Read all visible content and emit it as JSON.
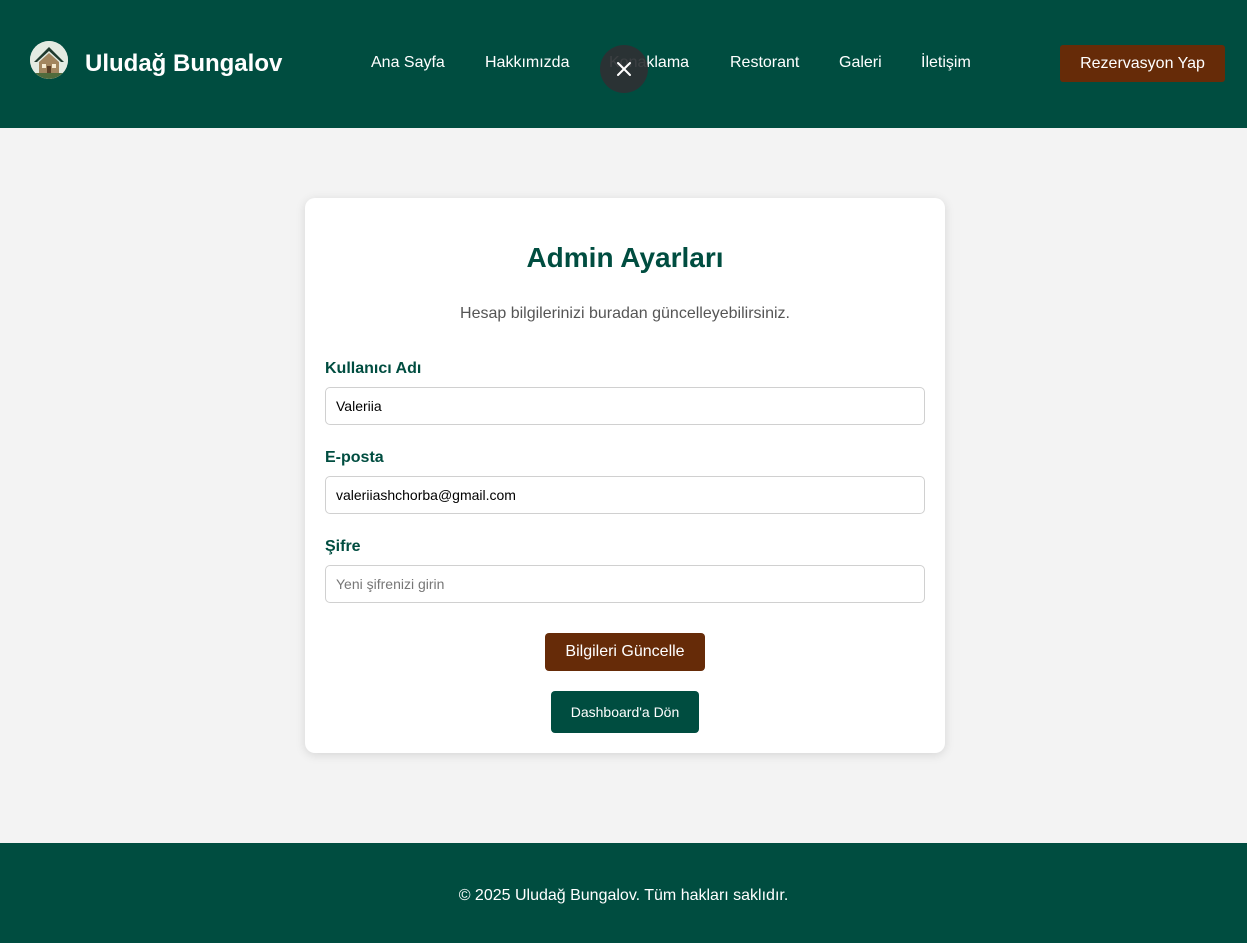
{
  "header": {
    "brand": "Uludağ Bungalov",
    "logo_icon": "house-logo-icon",
    "nav": [
      {
        "label": "Ana Sayfa"
      },
      {
        "label": "Hakkımızda"
      },
      {
        "label": "Konaklama"
      },
      {
        "label": "Restorant"
      },
      {
        "label": "Galeri"
      },
      {
        "label": "İletişim"
      }
    ],
    "close_icon": "close-icon",
    "cta_label": "Rezervasyon Yap"
  },
  "main": {
    "title": "Admin Ayarları",
    "subtitle": "Hesap bilgilerinizi buradan güncelleyebilirsiniz.",
    "fields": {
      "username": {
        "label": "Kullanıcı Adı",
        "value": "Valeriia"
      },
      "email": {
        "label": "E-posta",
        "value": "valeriiashchorba@gmail.com"
      },
      "password": {
        "label": "Şifre",
        "value": "",
        "placeholder": "Yeni şifrenizi girin"
      }
    },
    "update_button": "Bilgileri Güncelle",
    "back_button": "Dashboard'a Dön"
  },
  "footer": {
    "copyright": "© 2025 Uludağ Bungalov. Tüm hakları saklıdır."
  },
  "colors": {
    "primary": "#004d40",
    "accent": "#662b08",
    "background": "#f3f3f3"
  }
}
